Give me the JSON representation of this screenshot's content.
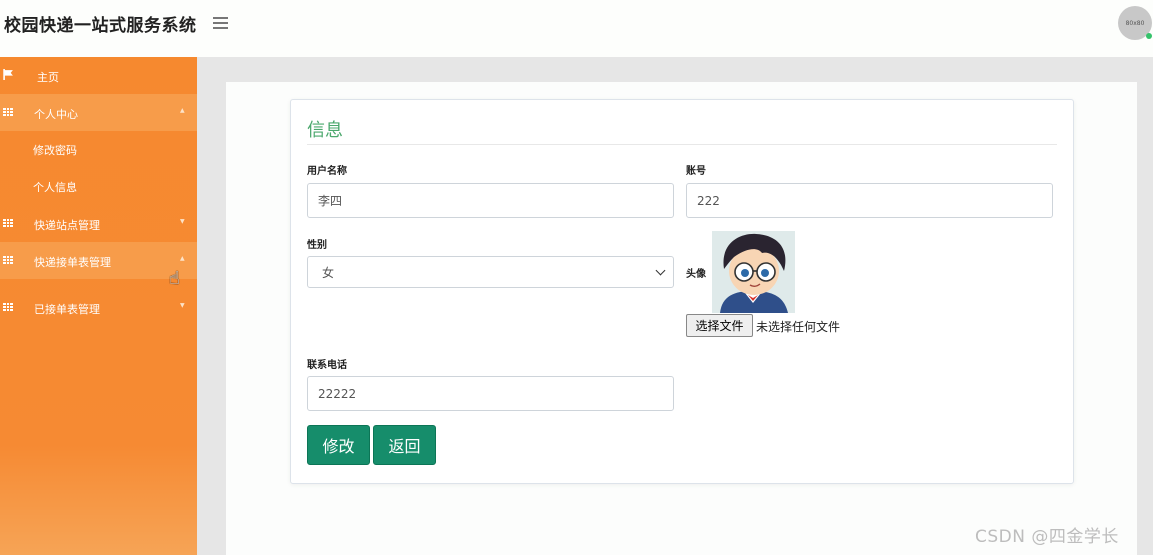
{
  "header": {
    "app_title": "校园快递一站式服务系统",
    "avatar_text": "80x80"
  },
  "sidebar": {
    "items": [
      {
        "label": "主页",
        "icon": "flag-icon"
      },
      {
        "label": "个人中心",
        "icon": "grid-icon",
        "active": true
      },
      {
        "label": "修改密码",
        "sub": true
      },
      {
        "label": "个人信息",
        "sub": true
      },
      {
        "label": "快递站点管理",
        "icon": "grid-icon"
      },
      {
        "label": "快递接单表管理",
        "icon": "grid-icon",
        "active": true
      },
      {
        "label": "已接单表管理",
        "icon": "grid-icon"
      }
    ],
    "caret_down": "▼",
    "caret_up": "▲"
  },
  "form": {
    "title": "信息",
    "username_label": "用户名称",
    "username_value": "李四",
    "account_label": "账号",
    "account_value": "222",
    "gender_label": "性别",
    "gender_value": "女",
    "avatar_label": "头像",
    "file_button": "选择文件",
    "file_status": "未选择任何文件",
    "phone_label": "联系电话",
    "phone_value": "22222",
    "modify_button": "修改",
    "back_button": "返回"
  },
  "watermark": "CSDN @四金学长",
  "colors": {
    "sidebar": "#f6892f",
    "sidebar_active": "#f79c4a",
    "title_green": "#4ba86d",
    "button": "#168d6b"
  }
}
